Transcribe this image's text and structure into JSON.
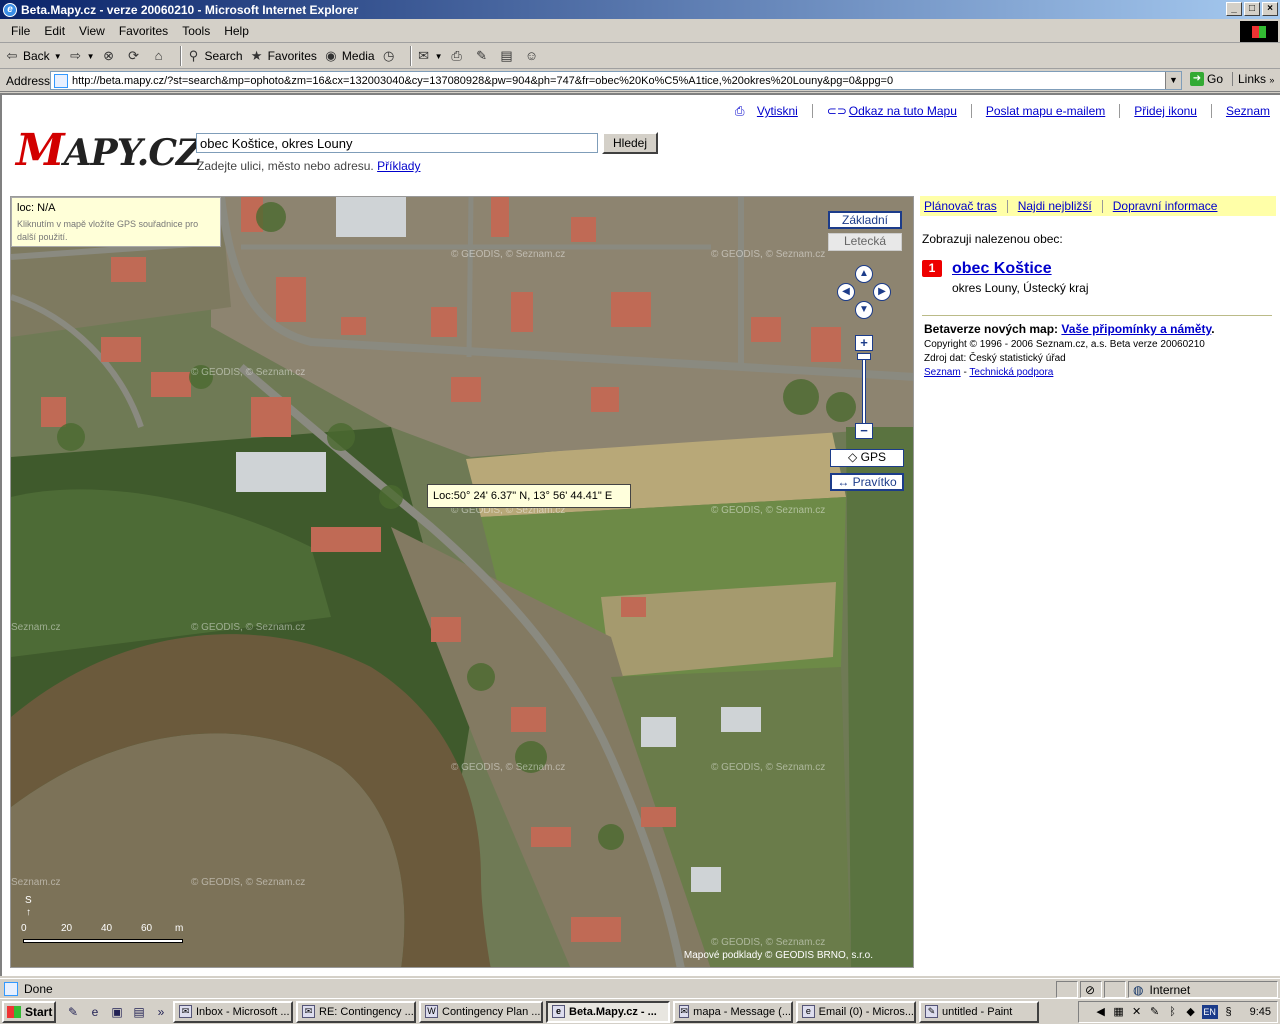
{
  "window": {
    "title": "Beta.Mapy.cz - verze 20060210 - Microsoft Internet Explorer",
    "controls": [
      "_",
      "□",
      "×"
    ]
  },
  "menu": [
    "File",
    "Edit",
    "View",
    "Favorites",
    "Tools",
    "Help"
  ],
  "toolbar": {
    "back": "Back",
    "search": "Search",
    "favorites": "Favorites",
    "media": "Media"
  },
  "address": {
    "label": "Address",
    "url": "http://beta.mapy.cz/?st=search&mp=ophoto&zm=16&cx=132003040&cy=137080928&pw=904&ph=747&fr=obec%20Ko%C5%A1tice,%20okres%20Louny&pg=0&ppg=0",
    "go": "Go",
    "links": "Links"
  },
  "page": {
    "toplinks": [
      "Vytiskni",
      "Odkaz na tuto Mapu",
      "Poslat mapu e-mailem",
      "Přidej ikonu",
      "Seznam"
    ],
    "logo_m": "M",
    "logo_rest": "APY.CZ",
    "search_value": "obec Koštice, okres Louny",
    "search_button": "Hledej",
    "hint": "Zadejte ulici, město nebo adresu.",
    "hint_link": "Příklady"
  },
  "map": {
    "loc_title": "loc: N/A",
    "loc_help": "Kliknutím v mapě vložíte GPS souřadnice pro další použití.",
    "btn_base": "Základní",
    "btn_aerial": "Letecká",
    "btn_gps": "◇ GPS",
    "btn_ruler": "↔ Pravítko",
    "zoom_in": "+",
    "zoom_out": "−",
    "coord_tooltip": "Loc:50° 24' 6.37\" N, 13° 56' 44.41\" E",
    "watermark": "© GEODIS, © Seznam.cz",
    "watermark_short": "Seznam.cz",
    "copyright": "Mapové podklady © GEODIS BRNO, s.r.o.",
    "scale_labels": [
      "0",
      "20",
      "40",
      "60",
      "m"
    ],
    "north": "S",
    "colors": {
      "field": "#b8a878",
      "forest": "#3f5a2c",
      "river": "#6b5a3c",
      "road": "#8a8a80",
      "roof": "#c06a55"
    }
  },
  "panel": {
    "links": [
      "Plánovač tras",
      "Najdi nejbližší",
      "Dopravní informace"
    ],
    "found_text": "Zobrazuji nalezenou obec:",
    "result_num": "1",
    "result_name": "obec Koštice",
    "result_sub": "okres Louny, Ústecký kraj",
    "beta_text": "Betaverze nových map:",
    "beta_link": "Vaše připomínky a náměty",
    "beta_end": ".",
    "copyright": "Copyright © 1996 - 2006 Seznam.cz, a.s. Beta verze 20060210",
    "source": "Zdroj dat: Český statistický úřad",
    "footer_link1": "Seznam",
    "footer_sep": "-",
    "footer_link2": "Technická podpora"
  },
  "status": {
    "text": "Done",
    "zone": "Internet"
  },
  "taskbar": {
    "start": "Start",
    "tasks": [
      "Inbox - Microsoft ...",
      "RE: Contingency ...",
      "Contingency Plan ...",
      "Beta.Mapy.cz - ...",
      "mapa - Message (...",
      "Email (0) - Micros...",
      "untitled - Paint"
    ],
    "active_index": 3,
    "clock": "9:45",
    "lang": "EN"
  }
}
